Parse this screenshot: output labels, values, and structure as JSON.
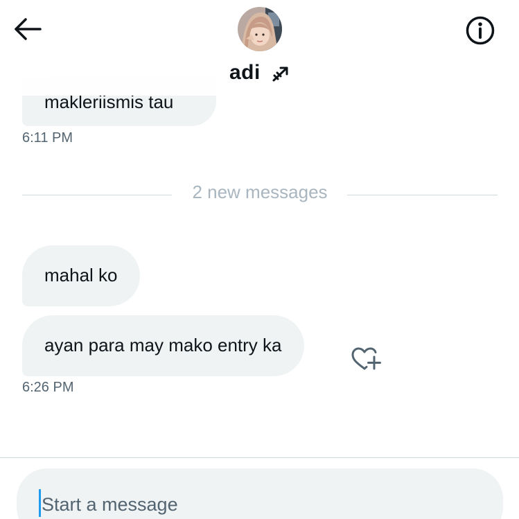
{
  "header": {
    "contact_name": "adi",
    "name_emoji": "arrow-emoji",
    "back_icon": "back-arrow-icon",
    "info_icon": "info-icon",
    "avatar": "contact-avatar"
  },
  "messages": {
    "top_partial_text": "makleriismis tau",
    "top_time": "6:11 PM",
    "divider_label": "2 new messages",
    "items": [
      {
        "text": "mahal ko"
      },
      {
        "text": "ayan para may mako entry ka"
      }
    ],
    "bottom_time": "6:26 PM",
    "react_icon": "heart-plus-icon"
  },
  "composer": {
    "placeholder": "Start a message"
  },
  "colors": {
    "bubble": "#eff3f4",
    "accent": "#1d9bf0",
    "muted_text": "#536471",
    "divider_text": "#a9b6bf"
  }
}
